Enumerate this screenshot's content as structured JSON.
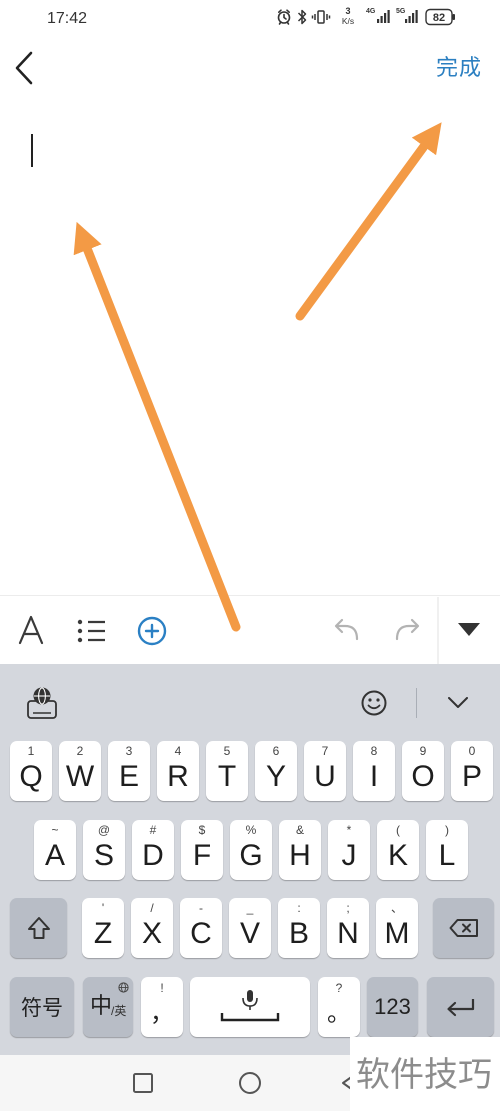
{
  "status_bar": {
    "time": "17:42",
    "net_speed_value": "3",
    "net_speed_unit": "K/s",
    "sim1_network": "4G",
    "sim2_network": "5G",
    "battery_level": "82",
    "icons": [
      "alarm-icon",
      "bluetooth-icon",
      "vibrate-icon",
      "signal-icon",
      "battery-icon"
    ]
  },
  "header": {
    "back_icon": "chevron-left-icon",
    "done_label": "完成",
    "accent_color": "#2b7fc1"
  },
  "format_toolbar": {
    "icons": [
      "text-format-icon",
      "bulleted-list-icon",
      "add-circle-icon",
      "undo-icon",
      "redo-icon",
      "collapse-toolbar-icon"
    ],
    "add_color": "#2b80c4",
    "disabled_color": "#b3b3b3"
  },
  "keyboard": {
    "top_bar_icons": [
      "keyboard-settings-icon",
      "emoji-icon",
      "hide-keyboard-icon"
    ],
    "row1": [
      {
        "label": "Q",
        "hint": "1"
      },
      {
        "label": "W",
        "hint": "2"
      },
      {
        "label": "E",
        "hint": "3"
      },
      {
        "label": "R",
        "hint": "4"
      },
      {
        "label": "T",
        "hint": "5"
      },
      {
        "label": "Y",
        "hint": "6"
      },
      {
        "label": "U",
        "hint": "7"
      },
      {
        "label": "I",
        "hint": "8"
      },
      {
        "label": "O",
        "hint": "9"
      },
      {
        "label": "P",
        "hint": "0"
      }
    ],
    "row2": [
      {
        "label": "A",
        "hint": "~"
      },
      {
        "label": "S",
        "hint": "@"
      },
      {
        "label": "D",
        "hint": "#"
      },
      {
        "label": "F",
        "hint": "$"
      },
      {
        "label": "G",
        "hint": "%"
      },
      {
        "label": "H",
        "hint": "&"
      },
      {
        "label": "J",
        "hint": "*"
      },
      {
        "label": "K",
        "hint": "("
      },
      {
        "label": "L",
        "hint": ")"
      }
    ],
    "row3": {
      "shift_icon": "shift-icon",
      "letters": [
        {
          "label": "Z",
          "hint": "'"
        },
        {
          "label": "X",
          "hint": "/"
        },
        {
          "label": "C",
          "hint": "-"
        },
        {
          "label": "V",
          "hint": "_"
        },
        {
          "label": "B",
          "hint": ":"
        },
        {
          "label": "N",
          "hint": ";"
        },
        {
          "label": "M",
          "hint": "、"
        }
      ],
      "delete_icon": "backspace-icon"
    },
    "row4": {
      "symbols_label": "符号",
      "lang_main": "中",
      "lang_sub": "/英",
      "comma_hint": "!",
      "comma_label": "，",
      "space_icon": "microphone-icon",
      "period_hint": "?",
      "period_label": "。",
      "numbers_label": "123",
      "enter_icon": "enter-icon"
    },
    "letter_key_color": "#ffffff",
    "function_key_color": "#b8bdc6",
    "background_color": "#d4d7dd"
  },
  "nav_bar": {
    "icons": [
      "recent-apps-icon",
      "home-icon",
      "back-icon"
    ]
  },
  "annotations": {
    "arrow_color": "#f39a45"
  },
  "watermark": {
    "text": "软件技巧"
  }
}
